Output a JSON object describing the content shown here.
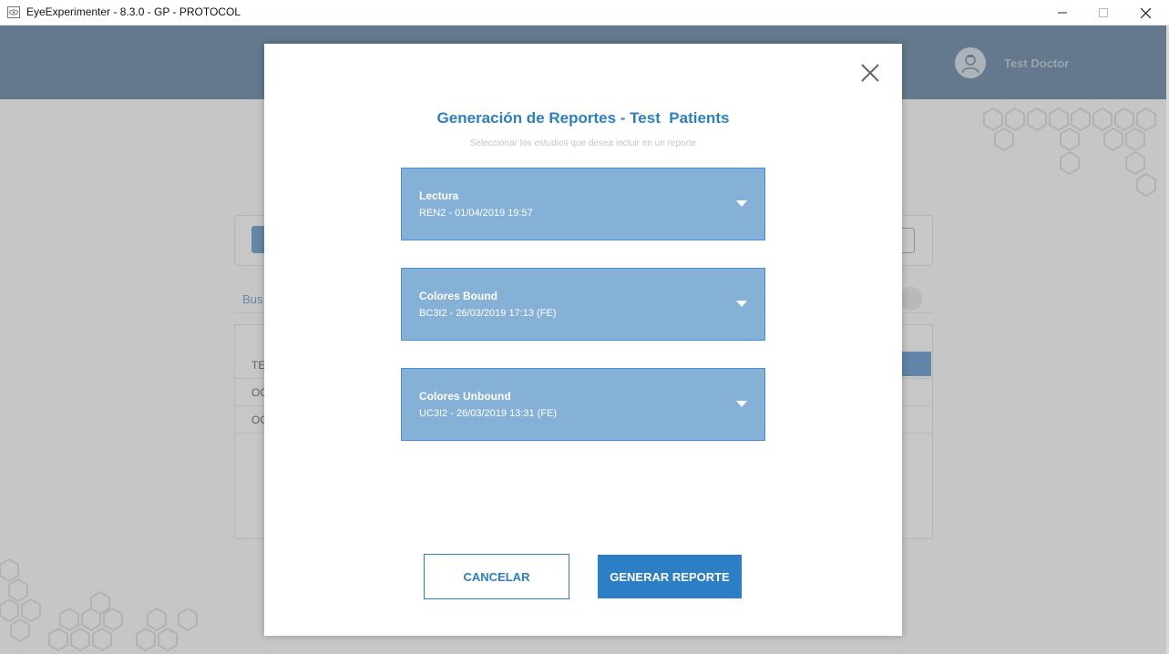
{
  "window": {
    "title": "EyeExperimenter - 8.3.0 - GP - PROTOCOL",
    "minimize_glyph": "—",
    "maximize_glyph": "☐",
    "close_glyph": "✕"
  },
  "header": {
    "doctor_name": "Test Doctor",
    "avatar_icon": "doctor-avatar-icon"
  },
  "background": {
    "search_label": "Bus",
    "rows": [
      "TE",
      "OC",
      "OC"
    ]
  },
  "modal": {
    "title": "Generación de Reportes - Test  Patients",
    "subtitle": "Seleccionar los estudios que desea incluir en un reporte",
    "studies": [
      {
        "name": "Lectura",
        "meta": "REN2 - 01/04/2019 19:57"
      },
      {
        "name": "Colores Bound",
        "meta": "BC3I2 - 26/03/2019 17:13 (FE)"
      },
      {
        "name": "Colores Unbound",
        "meta": "UC3I2 - 26/03/2019 13:31 (FE)"
      }
    ],
    "cancel_label": "CANCELAR",
    "generate_label": "GENERAR REPORTE"
  },
  "colors": {
    "accent": "#2c7fc4",
    "study_bg": "#86b1d6",
    "header_bg": "#5a7a99"
  }
}
